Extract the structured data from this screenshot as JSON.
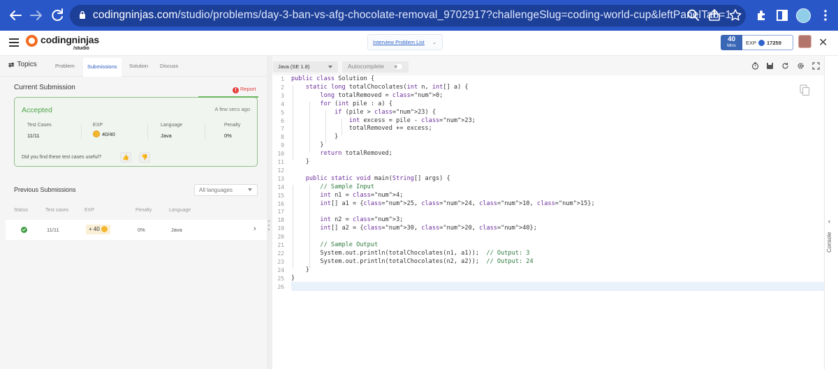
{
  "browser": {
    "url_host": "codingninjas.com",
    "url_path": "/studio/problems/day-3-ban-vs-afg-chocolate-removal_9702917?challengeSlug=coding-world-cup&leftPanelTab=1"
  },
  "header": {
    "logo_text": "codingninjas",
    "logo_sub": "/studio",
    "problem_list_label": "Interview Problem List",
    "level_value": "40",
    "level_label": "Mins",
    "exp_label": "EXP",
    "exp_value": "17259"
  },
  "left_panel": {
    "topics_label": "Topics",
    "tabs": [
      {
        "label": "Problem"
      },
      {
        "label": "Submissions"
      },
      {
        "label": "Solution"
      },
      {
        "label": "Discuss"
      }
    ],
    "current_title": "Current Submission",
    "report_label": "Report",
    "current": {
      "status": "Accepted",
      "time_ago": "A few secs ago",
      "labels": [
        "Test Cases",
        "EXP",
        "Language",
        "Penalty"
      ],
      "test_cases": "11/11",
      "exp": "40/40",
      "language": "Java",
      "penalty": "0%",
      "useful_question": "Did you find these test cases useful?"
    },
    "previous_title": "Previous Submissions",
    "filter_value": "All languages",
    "columns": [
      "Status",
      "Test cases",
      "EXP",
      "Penalty",
      "Language"
    ],
    "rows": [
      {
        "test_cases": "11/11",
        "exp": "+ 40",
        "penalty": "0%",
        "language": "Java"
      }
    ]
  },
  "editor": {
    "language": "Java (SE 1.8)",
    "autocomplete_label": "Autocomplete",
    "autocomplete_on": false,
    "lines": [
      "public class Solution {",
      "    static long totalChocolates(int n, int[] a) {",
      "        long totalRemoved = 0;",
      "        for (int pile : a) {",
      "            if (pile > 23) {",
      "                int excess = pile - 23;",
      "                totalRemoved += excess;",
      "            }",
      "        }",
      "        return totalRemoved;",
      "    }",
      "",
      "    public static void main(String[] args) {",
      "        // Sample Input",
      "        int n1 = 4;",
      "        int[] a1 = {25, 24, 10, 15};",
      "",
      "        int n2 = 3;",
      "        int[] a2 = {30, 20, 40};",
      "",
      "        // Sample Output",
      "        System.out.println(totalChocolates(n1, a1));  // Output: 3",
      "        System.out.println(totalChocolates(n2, a2));  // Output: 24",
      "    }",
      "}",
      ""
    ]
  },
  "console": {
    "label": "Console"
  }
}
